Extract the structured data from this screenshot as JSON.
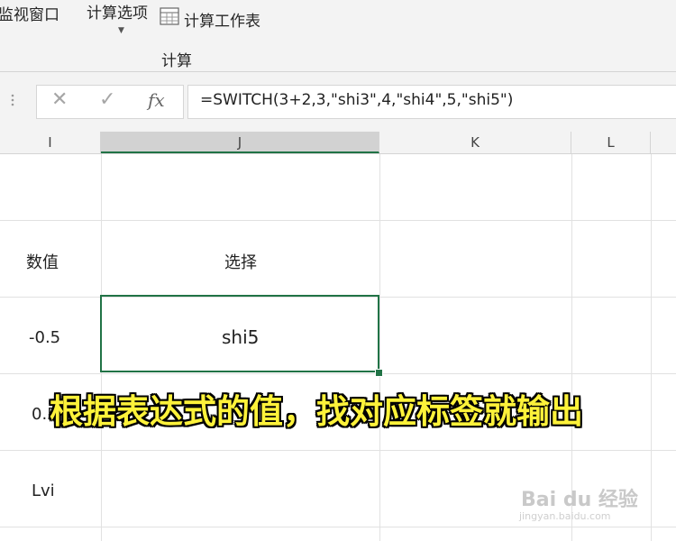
{
  "ribbon": {
    "watch_window_label": "监视窗口",
    "calc_options_label": "计算选项",
    "calc_sheet_label": "计算工作表",
    "group_label": "计算"
  },
  "formula_bar": {
    "cancel_icon": "✕",
    "enter_icon": "✓",
    "fx_label": "fx",
    "formula": "=SWITCH(3+2,3,\"shi3\",4,\"shi4\",5,\"shi5\")"
  },
  "columns": [
    "I",
    "J",
    "K",
    "L"
  ],
  "cells": {
    "i_header": "数值",
    "j_header": "选择",
    "i_row1": "-0.5",
    "j_row1": "shi5",
    "i_row2": "0.5",
    "i_row3": "Lvi"
  },
  "caption": "根据表达式的值，找对应标签就输出",
  "watermark": {
    "logo": "Bai du 经验",
    "url": "jingyan.baidu.com"
  },
  "colors": {
    "accent": "#217346",
    "caption": "#fdf23a"
  }
}
